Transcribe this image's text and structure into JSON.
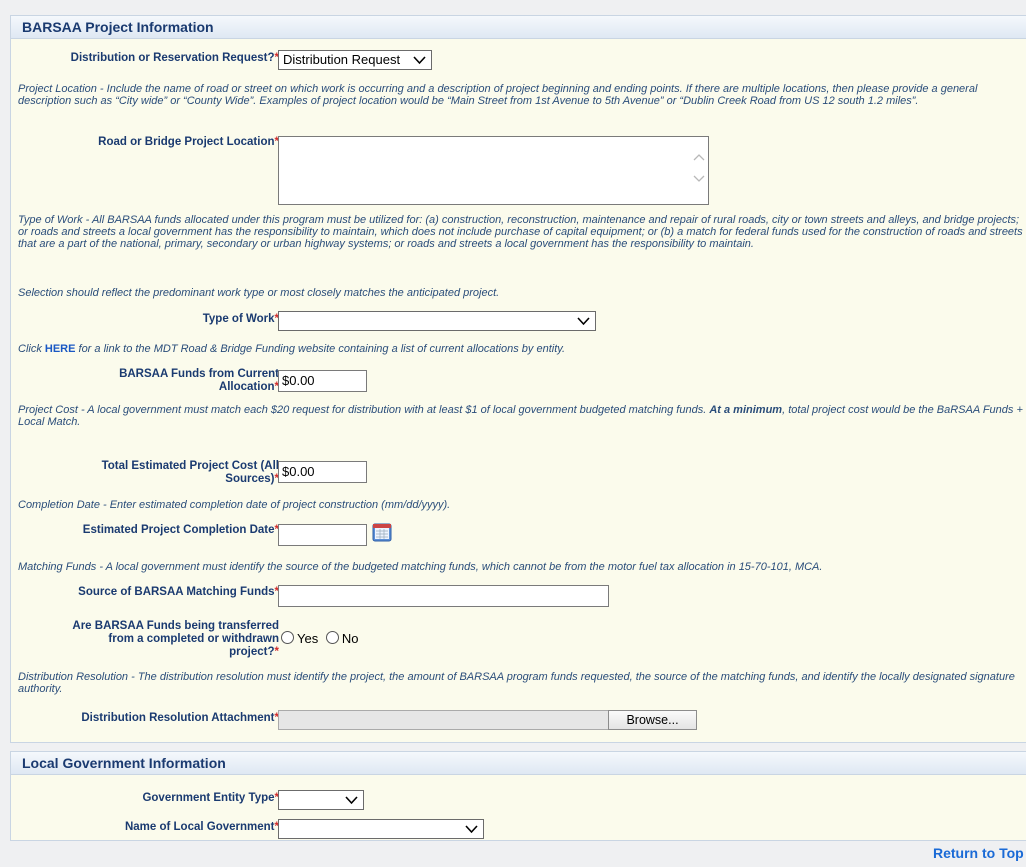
{
  "project_panel": {
    "title": "BARSAA Project Information",
    "distribution_label": "Distribution or Reservation Request?",
    "distribution_value": "Distribution Request",
    "location_help": "Project Location - Include the name of road or street on which work is occurring and a description of project beginning and ending points. If there are multiple locations, then please provide a general description such as “City wide” or “County Wide”. Examples of project location would be “Main Street from 1st Avenue to 5th Avenue” or “Dublin Creek Road from US 12 south 1.2 miles”.",
    "location_label": "Road or Bridge Project Location",
    "location_value": "",
    "work_help": "Type of Work - All BARSAA funds allocated under this program must be utilized for: (a) construction, reconstruction, maintenance and repair of rural roads, city or town streets and alleys, and bridge projects; or roads and streets a local government has the responsibility to maintain, which does not include purchase of capital equipment; or (b) a match for federal funds used for the construction of roads and streets that are a part of the national, primary, secondary or urban highway systems; or roads and streets a local government has the responsibility to maintain.",
    "selection_help": "Selection should reflect the predominant work type or most closely matches the anticipated project.",
    "work_type_label": "Type of Work",
    "work_type_value": "",
    "click_prefix": "Click ",
    "click_link": "HERE",
    "click_suffix": " for a link to the MDT Road & Bridge Funding website containing a list of current allocations by entity.",
    "funds_label_line1": "BARSAA Funds from Current",
    "funds_label_line2": "Allocation",
    "funds_value": "$0.00",
    "cost_help_a": "Project Cost - A local government must match each $20 request for distribution with at least $1 of local government budgeted matching funds. ",
    "cost_help_bold": "At a minimum",
    "cost_help_b": ", total project cost would be the BaRSAA Funds + Local Match.",
    "total_label_line1": "Total Estimated Project Cost (All",
    "total_label_line2": "Sources)",
    "total_value": "$0.00",
    "completion_help": "Completion Date - Enter estimated completion date of project construction (mm/dd/yyyy).",
    "completion_label": "Estimated Project Completion Date",
    "completion_value": "",
    "matching_help": "Matching Funds - A local government must identify the source of the budgeted matching funds, which cannot be from the motor fuel tax allocation in 15-70-101, MCA.",
    "matching_label": "Source of BARSAA Matching Funds",
    "matching_value": "",
    "transfer_label_line1": "Are BARSAA Funds being transferred",
    "transfer_label_line2": "from a completed or withdrawn",
    "transfer_label_line3": "project?",
    "yes_label": "Yes",
    "no_label": "No",
    "resolution_help": "Distribution Resolution - The distribution resolution must identify the project, the amount of BARSAA program funds requested, the source of the matching funds, and identify the locally designated signature authority.",
    "attachment_label": "Distribution Resolution Attachment",
    "browse_label": "Browse..."
  },
  "gov_panel": {
    "title": "Local Government Information",
    "entity_type_label": "Government Entity Type",
    "entity_type_value": "",
    "gov_name_label": "Name of Local Government",
    "gov_name_value": ""
  },
  "required_mark": "*",
  "return_to_top": "Return to Top",
  "colors": {
    "panel_bg": "#fbfbec",
    "header_text": "#1a3a70",
    "help_text": "#2a4d7a",
    "required": "#d12b2b",
    "link": "#1a6ad6"
  }
}
